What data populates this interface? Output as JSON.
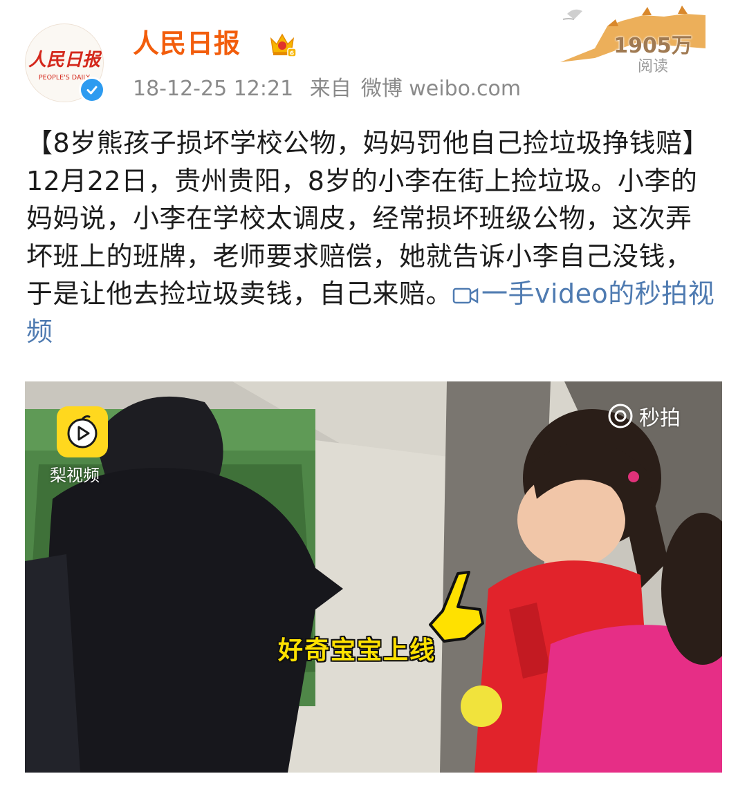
{
  "post": {
    "account_name": "人民日报",
    "avatar_text": "人民日报",
    "avatar_subtext": "PEOPLE'S DAILY",
    "timestamp": "18-12-25 12:21",
    "source_prefix": "来自",
    "source": "微博 weibo.com",
    "read_count": "1905万",
    "read_label": "阅读",
    "body_text": "【8岁熊孩子损坏学校公物，妈妈罚他自己捡垃圾挣钱赔】12月22日，贵州贵阳，8岁的小李在街上捡垃圾。小李的妈妈说，小李在学校太调皮，经常损坏班级公物，这次弄坏班上的班牌，老师要求赔偿，她就告诉小李自己没钱，于是让他去捡垃圾卖钱，自己来赔。",
    "video_link_text": "一手video的秒拍视频"
  },
  "media": {
    "pear_video_label": "梨视频",
    "miaopai_label": "秒拍",
    "caption": "好奇宝宝上线"
  },
  "colors": {
    "account_name": "#f25d0c",
    "link": "#4f7bb1",
    "verified_badge": "#2d9bf0",
    "caption": "#ffe100"
  }
}
